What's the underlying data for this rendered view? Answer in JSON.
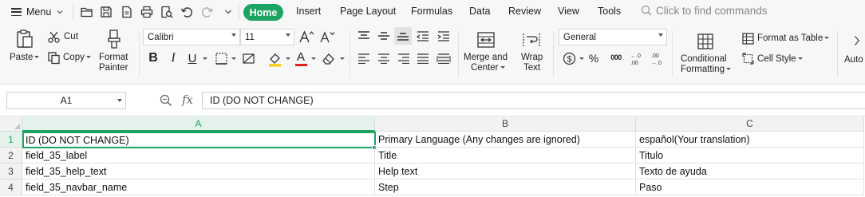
{
  "menubar": {
    "menu_label": "Menu",
    "tabs": [
      "Home",
      "Insert",
      "Page Layout",
      "Formulas",
      "Data",
      "Review",
      "View",
      "Tools"
    ],
    "search_placeholder": "Click to find commands",
    "accent_color": "#1da362"
  },
  "ribbon": {
    "paste": "Paste",
    "cut": "Cut",
    "copy": "Copy",
    "format_painter_line1": "Format",
    "format_painter_line2": "Painter",
    "font_name": "Calibri",
    "font_size": "11",
    "merge_line1": "Merge and",
    "merge_line2": "Center",
    "wrap_line1": "Wrap",
    "wrap_line2": "Text",
    "number_format": "General",
    "conditional_line1": "Conditional",
    "conditional_line2": "Formatting",
    "format_as_table": "Format as Table",
    "cell_style": "Cell Style",
    "autosum_partial": "Auto",
    "bold": "B",
    "italic": "I",
    "underline": "U",
    "font_color": "A",
    "font_color_value": "#e0201b",
    "fill_color_value": "#f6d017",
    "currency_symbol": "$",
    "percent_symbol": "%",
    "thousands_symbol": "000",
    "dec_increase": "+.0 .00",
    "dec_decrease": ".00 →.0"
  },
  "formula_bar": {
    "name_box": "A1",
    "fx": "fx",
    "value": "ID (DO NOT CHANGE)"
  },
  "sheet": {
    "columns": [
      "A",
      "B",
      "C"
    ],
    "rows": [
      {
        "num": "1",
        "cells": [
          "ID (DO NOT CHANGE)",
          "Primary Language (Any changes are ignored)",
          "español(Your translation)"
        ]
      },
      {
        "num": "2",
        "cells": [
          "field_35_label",
          "Title",
          "Titulo"
        ]
      },
      {
        "num": "3",
        "cells": [
          "field_35_help_text",
          "Help text",
          "Texto de ayuda"
        ]
      },
      {
        "num": "4",
        "cells": [
          "field_35_navbar_name",
          "Step",
          "Paso"
        ]
      }
    ]
  }
}
